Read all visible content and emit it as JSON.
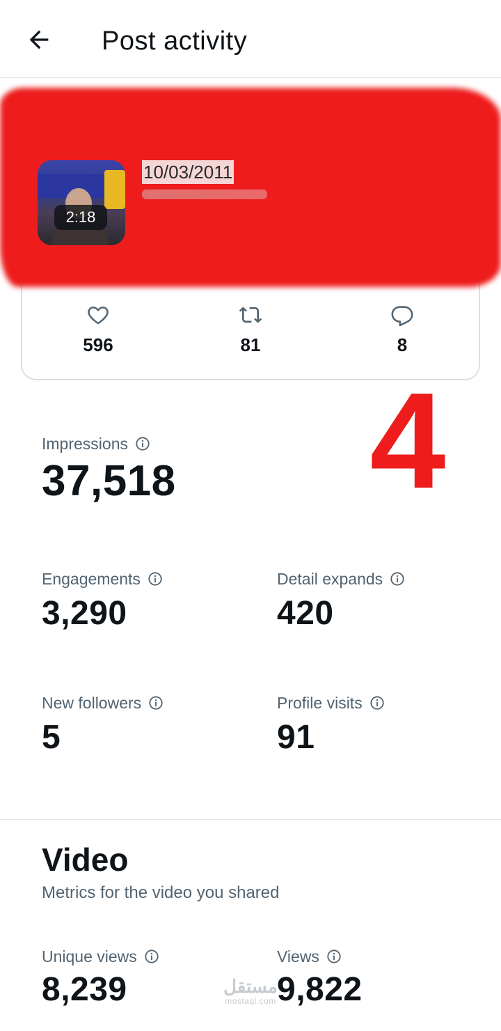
{
  "header": {
    "title": "Post activity",
    "back_icon": "arrow-left-icon"
  },
  "post": {
    "date": "10/03/2011",
    "video_duration": "2:18",
    "redaction_color": "#ee1c1c"
  },
  "engagement_counts": [
    {
      "icon": "heart-icon",
      "value": "596"
    },
    {
      "icon": "repost-icon",
      "value": "81"
    },
    {
      "icon": "reply-icon",
      "value": "8"
    }
  ],
  "annotation_number": "4",
  "metrics": {
    "impressions": {
      "label": "Impressions",
      "value": "37,518"
    },
    "engagements": {
      "label": "Engagements",
      "value": "3,290"
    },
    "detail_expands": {
      "label": "Detail expands",
      "value": "420"
    },
    "new_followers": {
      "label": "New followers",
      "value": "5"
    },
    "profile_visits": {
      "label": "Profile visits",
      "value": "91"
    }
  },
  "video_section": {
    "title": "Video",
    "subtitle": "Metrics for the video you shared",
    "unique_views": {
      "label": "Unique views",
      "value": "8,239"
    },
    "views": {
      "label": "Views",
      "value": "9,822"
    }
  },
  "watermark": {
    "arabic": "مستقل",
    "latin": "mostaql.com"
  },
  "colors": {
    "text_primary": "#0f1419",
    "text_secondary": "#536471",
    "border": "#e1e6ea",
    "annotation_red": "#ee1c1c"
  }
}
